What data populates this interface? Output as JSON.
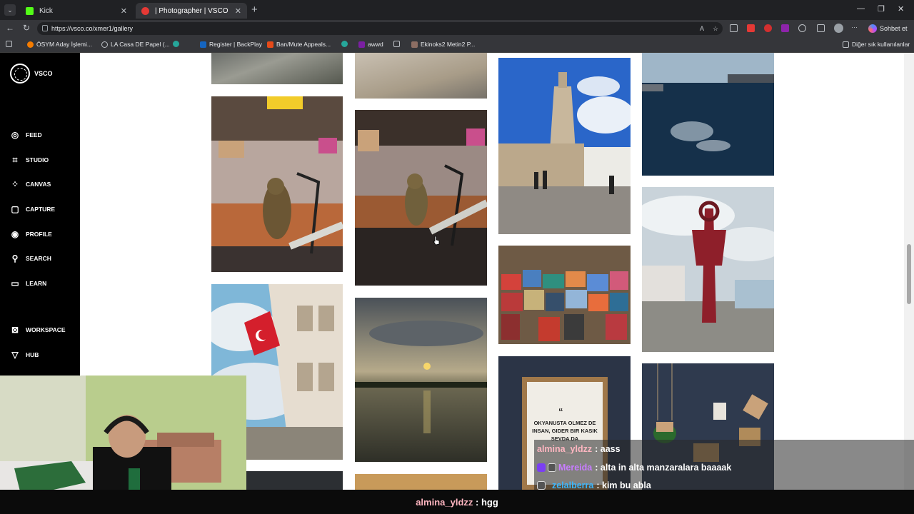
{
  "browser": {
    "tabs": [
      {
        "label": "Kick",
        "active": false
      },
      {
        "label": "| Photographer | VSCO",
        "active": true
      }
    ],
    "url": "https://vsco.co/xmer1/gallery",
    "bookmarks": [
      "ÖSYM Aday İşlemi...",
      "LA Casa DE Papel (...",
      "Register | BackPlay",
      "Ban/Mute Appeals...",
      "awwd",
      "Ekinoks2 Metin2 P..."
    ],
    "other_bookmarks": "Diğer sık kullanılanlar",
    "copilot_label": "Sohbet et"
  },
  "sidebar": {
    "brand": "VSCO",
    "items": [
      {
        "label": "FEED",
        "icon": "globe-icon"
      },
      {
        "label": "STUDIO",
        "icon": "crop-icon"
      },
      {
        "label": "CANVAS",
        "icon": "canvas-icon"
      },
      {
        "label": "CAPTURE",
        "icon": "capture-icon"
      },
      {
        "label": "PROFILE",
        "icon": "profile-icon"
      },
      {
        "label": "SEARCH",
        "icon": "search-icon"
      },
      {
        "label": "LEARN",
        "icon": "book-icon"
      },
      {
        "label": "WORKSPACE",
        "icon": "workspace-icon"
      },
      {
        "label": "HUB",
        "icon": "hub-icon"
      }
    ]
  },
  "poster": {
    "quote": "OKYANUSTA OLMEZ DE INSAN, GIDER BIR KASIK SEVDA DA"
  },
  "chat": [
    {
      "user": "almina_yldzz",
      "message": ": aass",
      "color": "#ffb6c1"
    },
    {
      "user": "Mereida",
      "message": ": alta in alta manzaralara baaaak",
      "color": "#c77dff"
    },
    {
      "user": "zelalberra",
      "message": ": kim bu abla",
      "color": "#3ab7ff"
    }
  ],
  "chat_bottom": {
    "user": "almina_yldzz",
    "message": ": hgg",
    "color": "#ffb6c1"
  }
}
